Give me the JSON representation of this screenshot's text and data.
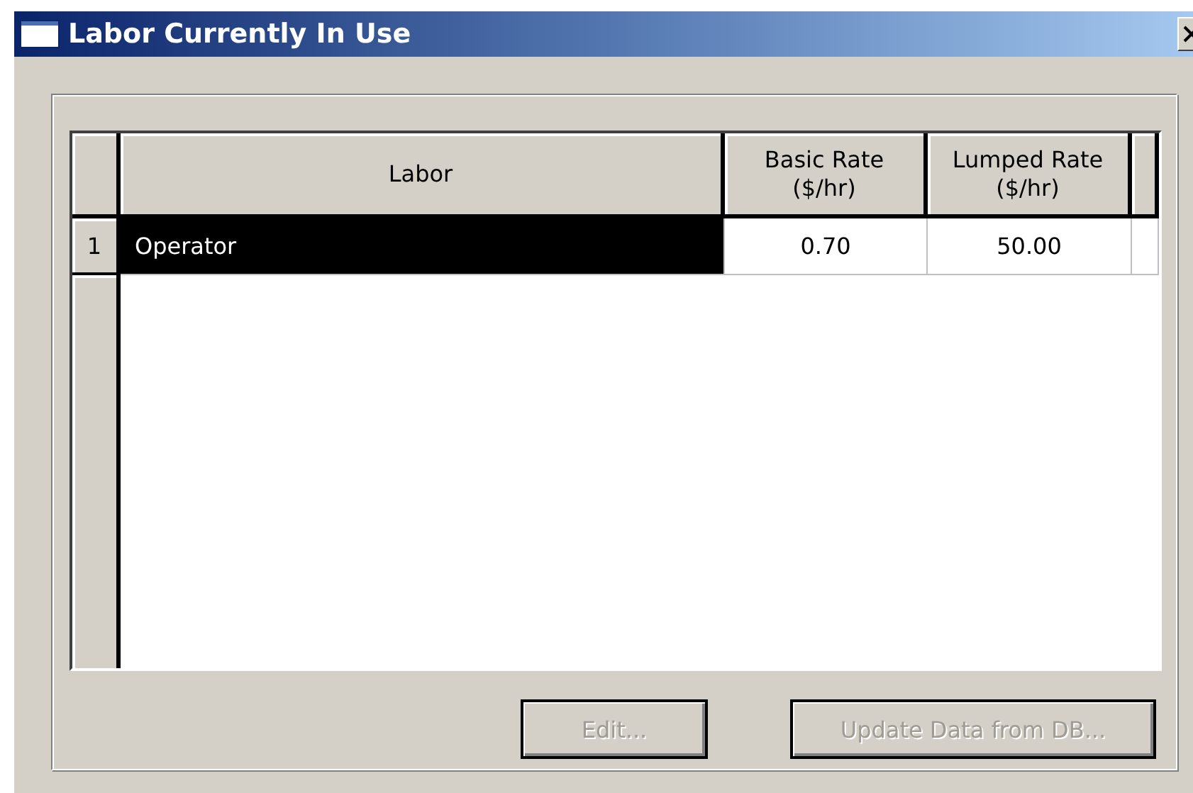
{
  "window": {
    "title": "Labor Currently In Use"
  },
  "table": {
    "columns": [
      "Labor",
      "Basic Rate\n($/hr)",
      "Lumped Rate\n($/hr)"
    ],
    "rows": [
      {
        "number": "1",
        "selected": true,
        "cells": [
          "Operator",
          "0.70",
          "50.00"
        ]
      }
    ]
  },
  "buttons": [
    {
      "label": "Edit...",
      "disabled": true
    },
    {
      "label": "Update Data from DB...",
      "disabled": true
    }
  ]
}
